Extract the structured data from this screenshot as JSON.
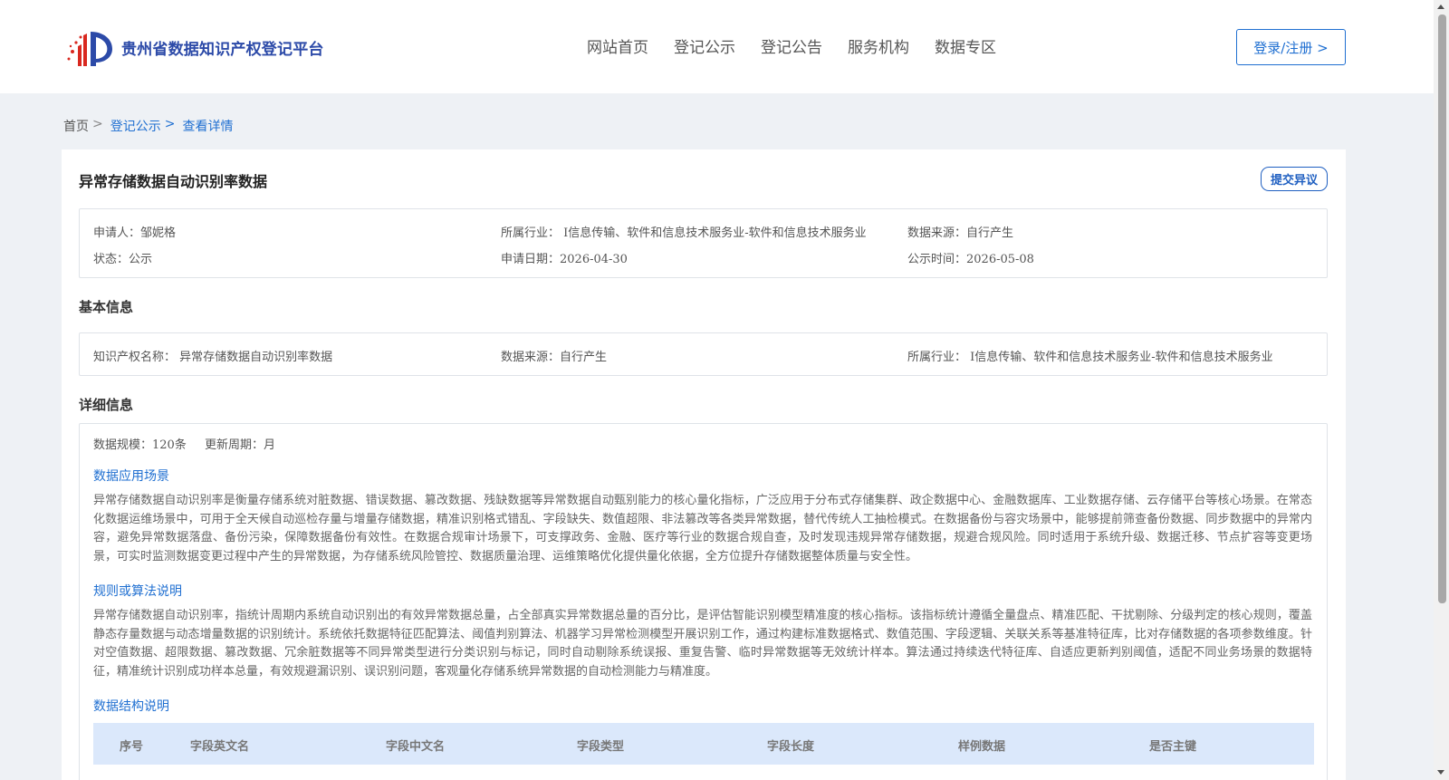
{
  "header": {
    "site_name": "贵州省数据知识产权登记平台",
    "nav": [
      "网站首页",
      "登记公示",
      "登记公告",
      "服务机构",
      "数据专区"
    ],
    "login_label": "登录/注册 >"
  },
  "breadcrumb": {
    "home": "首页",
    "sep": ">",
    "crumb1": "登记公示",
    "crumb2": "查看详情"
  },
  "record": {
    "title": "异常存储数据自动识别率数据",
    "dispute_label": "提交异议",
    "summary": {
      "applicant": "申请人：邹妮格",
      "industry": "所属行业： I信息传输、软件和信息技术服务业-软件和信息技术服务业",
      "source": "数据来源：自行产生",
      "status": "状态：公示",
      "apply_date": "申请日期：2026-04-30",
      "publish_date": "公示时间：2026-05-08"
    },
    "basic_title": "基本信息",
    "basic": {
      "ip_name": "知识产权名称： 异常存储数据自动识别率数据",
      "source": "数据来源：自行产生",
      "industry": "所属行业： I信息传输、软件和信息技术服务业-软件和信息技术服务业"
    },
    "detail_title": "详细信息",
    "detail": {
      "scale": "数据规模：120条",
      "cycle": "更新周期：月",
      "scenario_title": "数据应用场景",
      "scenario_text": "异常存储数据自动识别率是衡量存储系统对脏数据、错误数据、篡改数据、残缺数据等异常数据自动甄别能力的核心量化指标，广泛应用于分布式存储集群、政企数据中心、金融数据库、工业数据存储、云存储平台等核心场景。在常态化数据运维场景中，可用于全天候自动巡检存量与增量存储数据，精准识别格式错乱、字段缺失、数值超限、非法篡改等各类异常数据，替代传统人工抽检模式。在数据备份与容灾场景中，能够提前筛查备份数据、同步数据中的异常内容，避免异常数据落盘、备份污染，保障数据备份有效性。在数据合规审计场景下，可支撑政务、金融、医疗等行业的数据合规自查，及时发现违规异常存储数据，规避合规风险。同时适用于系统升级、数据迁移、节点扩容等变更场景，可实时监测数据变更过程中产生的异常数据，为存储系统风险管控、数据质量治理、运维策略优化提供量化依据，全方位提升存储数据整体质量与安全性。",
      "rule_title": "规则或算法说明",
      "rule_text": "异常存储数据自动识别率，指统计周期内系统自动识别出的有效异常数据总量，占全部真实异常数据总量的百分比，是评估智能识别模型精准度的核心指标。该指标统计遵循全量盘点、精准匹配、干扰剔除、分级判定的核心规则，覆盖静态存量数据与动态增量数据的识别统计。系统依托数据特征匹配算法、阈值判别算法、机器学习异常检测模型开展识别工作，通过构建标准数据格式、数值范围、字段逻辑、关联关系等基准特征库，比对存储数据的各项参数维度。针对空值数据、超限数据、篡改数据、冗余脏数据等不同异常类型进行分类识别与标记，同时自动剔除系统误报、重复告警、临时异常数据等无效统计样本。算法通过持续迭代特征库、自适应更新判别阈值，适配不同业务场景的数据特征，精准统计识别成功样本总量，有效规避漏识别、误识别问题，客观量化存储系统异常数据的自动检测能力与精准度。",
      "structure_title": "数据结构说明",
      "table_headers": [
        "序号",
        "字段英文名",
        "字段中文名",
        "字段类型",
        "字段长度",
        "样例数据",
        "是否主键"
      ]
    }
  },
  "colors": {
    "brand_blue": "#2c4aa8",
    "link_blue": "#1f6fd1",
    "table_head_bg": "#dbe8fb",
    "page_bg": "#eef1f5"
  }
}
